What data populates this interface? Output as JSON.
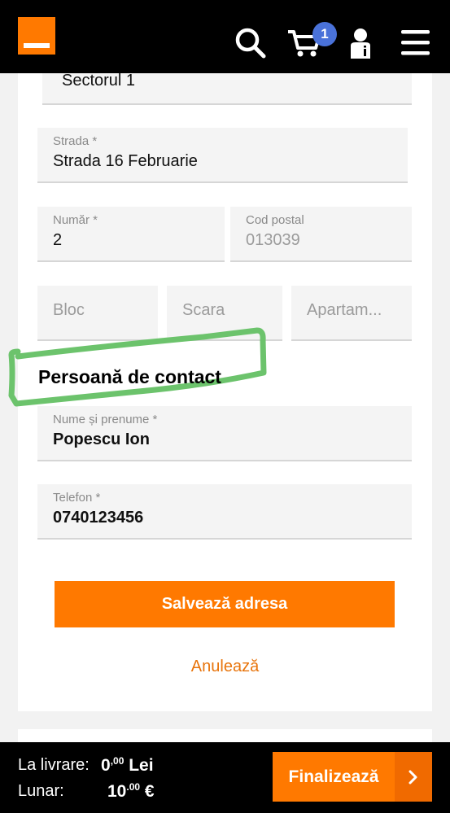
{
  "header": {
    "logo": "orange-logo",
    "cart_count": "1"
  },
  "address": {
    "sector_value": "Sectorul 1",
    "street_label": "Strada *",
    "street_value": "Strada 16 Februarie",
    "number_label": "Număr *",
    "number_value": "2",
    "postal_label": "Cod postal",
    "postal_value": "013039",
    "block_placeholder": "Bloc",
    "stair_placeholder": "Scara",
    "apartment_placeholder": "Apartam..."
  },
  "contact": {
    "title": "Persoană de contact",
    "name_label": "Nume și prenume *",
    "name_value": "Popescu Ion",
    "phone_label": "Telefon *",
    "phone_value": "0740123456"
  },
  "actions": {
    "save_label": "Salvează adresa",
    "cancel_label": "Anulează"
  },
  "footer": {
    "delivery_label": "La livrare:",
    "delivery_int": "0",
    "delivery_dec": ",00",
    "delivery_currency": "Lei",
    "monthly_label": "Lunar:",
    "monthly_int": "10",
    "monthly_dec": ".00",
    "monthly_currency": "€",
    "checkout_label": "Finalizează"
  },
  "colors": {
    "brand": "#ff7900",
    "badge": "#4a72d9",
    "highlight": "#6cc36c"
  }
}
